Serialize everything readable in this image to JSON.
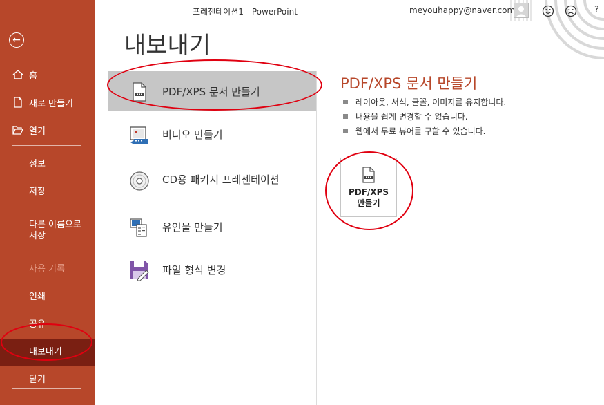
{
  "titlebar": {
    "doc_title": "프레젠테이션1  -  PowerPoint",
    "account": "meyouhappy@naver.com",
    "help": "?"
  },
  "sidebar": {
    "back_icon": "back-arrow-icon",
    "top_items": [
      {
        "label": "홈",
        "icon": "home-icon"
      },
      {
        "label": "새로 만들기",
        "icon": "new-document-icon"
      },
      {
        "label": "열기",
        "icon": "folder-open-icon"
      }
    ],
    "items": [
      {
        "label": "정보"
      },
      {
        "label": "저장"
      },
      {
        "label": "다른 이름으로 저장"
      },
      {
        "label": "사용 기록"
      },
      {
        "label": "인쇄"
      },
      {
        "label": "공유"
      },
      {
        "label": "내보내기"
      },
      {
        "label": "닫기"
      }
    ],
    "accent_color": "#b7472a",
    "selected_color": "#7a1f12"
  },
  "main": {
    "page_title": "내보내기",
    "export_options": [
      {
        "label": "PDF/XPS 문서 만들기",
        "icon": "pdf-document-icon",
        "selected": true
      },
      {
        "label": "비디오 만들기",
        "icon": "video-icon"
      },
      {
        "label": "CD용 패키지 프레젠테이션",
        "icon": "cd-icon"
      },
      {
        "label": "유인물 만들기",
        "icon": "handout-icon"
      },
      {
        "label": "파일 형식 변경",
        "icon": "save-disk-icon"
      }
    ]
  },
  "detail": {
    "title": "PDF/XPS 문서 만들기",
    "bullets": [
      "레이아웃, 서식, 글꼴, 이미지를 유지합니다.",
      "내용을 쉽게 변경할 수 없습니다.",
      "웹에서 무료 뷰어를 구할 수 있습니다."
    ],
    "button_line1": "PDF/XPS",
    "button_line2": "만들기",
    "title_color": "#b7472a"
  },
  "annotations": {
    "circle_color": "#e00010"
  }
}
